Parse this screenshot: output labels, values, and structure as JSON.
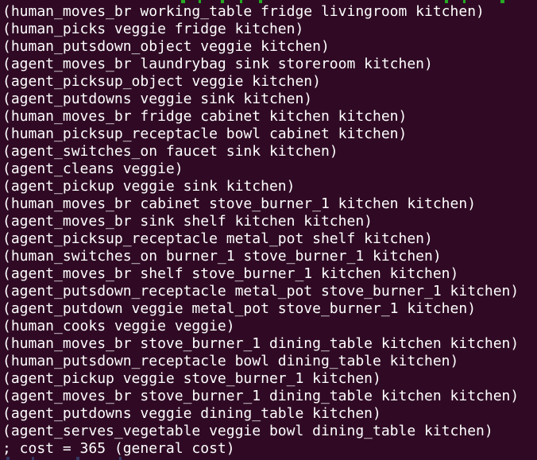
{
  "terminal": {
    "lines": [
      "(human_moves_br working_table fridge livingroom kitchen)",
      "(human_picks veggie fridge kitchen)",
      "(human_putsdown_object veggie kitchen)",
      "(agent_moves_br laundrybag sink storeroom kitchen)",
      "(agent_picksup_object veggie kitchen)",
      "(agent_putdowns veggie sink kitchen)",
      "(human_moves_br fridge cabinet kitchen kitchen)",
      "(human_picksup_receptacle bowl cabinet kitchen)",
      "(agent_switches_on faucet sink kitchen)",
      "(agent_cleans veggie)",
      "(agent_pickup veggie sink kitchen)",
      "(human_moves_br cabinet stove_burner_1 kitchen kitchen)",
      "(agent_moves_br sink shelf kitchen kitchen)",
      "(agent_picksup_receptacle metal_pot shelf kitchen)",
      "(human_switches_on burner_1 stove_burner_1 kitchen)",
      "(agent_moves_br shelf stove_burner_1 kitchen kitchen)",
      "(agent_putsdown_receptacle metal_pot stove_burner_1 kitchen)",
      "(agent_putdown veggie metal_pot stove_burner_1 kitchen)",
      "(human_cooks veggie veggie)",
      "(human_moves_br stove_burner_1 dining_table kitchen kitchen)",
      "(human_putsdown_receptacle bowl dining_table kitchen)",
      "(agent_pickup veggie stove_burner_1 kitchen)",
      "(agent_moves_br stove_burner_1 dining_table kitchen kitchen)",
      "(agent_putdowns veggie dining_table kitchen)",
      "(agent_serves_vegetable veggie bowl dining_table kitchen)",
      "; cost = 365 (general cost)"
    ]
  },
  "colors": {
    "background": "#300a24",
    "foreground": "#ffffff",
    "top_highlight": "#25bc24",
    "bottom_highlight": "#3a8fd6"
  }
}
